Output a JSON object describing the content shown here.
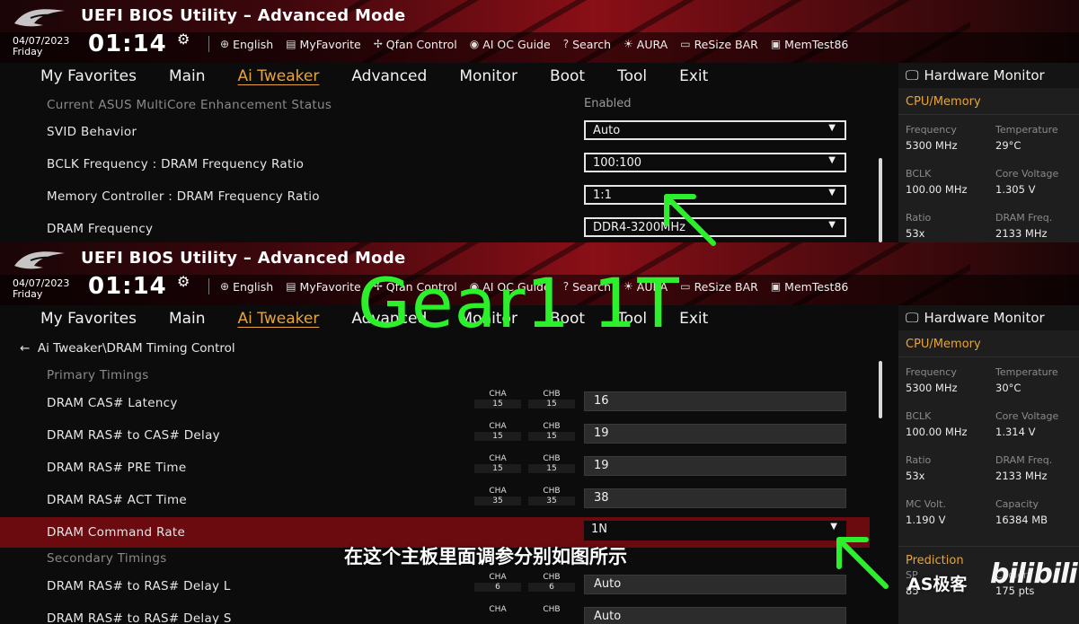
{
  "header": {
    "title": "UEFI BIOS Utility – Advanced Mode",
    "date": "04/07/2023",
    "day": "Friday",
    "time": "01:14",
    "toolbar": [
      {
        "icon": "globe-icon",
        "label": "English"
      },
      {
        "icon": "favorite-icon",
        "label": "MyFavorite"
      },
      {
        "icon": "fan-icon",
        "label": "Qfan Control"
      },
      {
        "icon": "ai-oc-icon",
        "label": "AI OC Guide"
      },
      {
        "icon": "search-icon",
        "label": "Search"
      },
      {
        "icon": "aura-icon",
        "label": "AURA"
      },
      {
        "icon": "resize-bar-icon",
        "label": "ReSize BAR"
      },
      {
        "icon": "memtest-icon",
        "label": "MemTest86"
      }
    ]
  },
  "nav": {
    "tabs": [
      "My Favorites",
      "Main",
      "Ai Tweaker",
      "Advanced",
      "Monitor",
      "Boot",
      "Tool",
      "Exit"
    ],
    "active": "Ai Tweaker"
  },
  "top_panel": {
    "rows": [
      {
        "label": "Current ASUS MultiCore Enhancement Status",
        "value": "Enabled"
      },
      {
        "label": "SVID Behavior",
        "value": "Auto"
      },
      {
        "label": "BCLK Frequency : DRAM Frequency Ratio",
        "value": "100:100"
      },
      {
        "label": "Memory Controller : DRAM Frequency Ratio",
        "value": "1:1"
      },
      {
        "label": "DRAM Frequency",
        "value": "DDR4-3200MHz"
      }
    ],
    "hw": {
      "title": "Hardware Monitor",
      "section": "CPU/Memory",
      "items": [
        {
          "k": "Frequency",
          "v": "5300 MHz"
        },
        {
          "k": "Temperature",
          "v": "29°C"
        },
        {
          "k": "BCLK",
          "v": "100.00 MHz"
        },
        {
          "k": "Core Voltage",
          "v": "1.305 V"
        },
        {
          "k": "Ratio",
          "v": "53x"
        },
        {
          "k": "DRAM Freq.",
          "v": "2133 MHz"
        }
      ]
    }
  },
  "bottom_panel": {
    "breadcrumb": "Ai Tweaker\\DRAM Timing Control",
    "primary_title": "Primary Timings",
    "secondary_title": "Secondary Timings",
    "cha_label": "CHA",
    "chb_label": "CHB",
    "rows": [
      {
        "label": "DRAM CAS# Latency",
        "cha": "15",
        "chb": "15",
        "value": "16"
      },
      {
        "label": "DRAM RAS# to CAS# Delay",
        "cha": "15",
        "chb": "15",
        "value": "19"
      },
      {
        "label": "DRAM RAS# PRE Time",
        "cha": "15",
        "chb": "15",
        "value": "19"
      },
      {
        "label": "DRAM RAS# ACT Time",
        "cha": "35",
        "chb": "35",
        "value": "38"
      },
      {
        "label": "DRAM Command Rate",
        "value": "1N"
      },
      {
        "label": "DRAM RAS# to RAS# Delay L",
        "cha": "6",
        "chb": "6",
        "value": "Auto"
      },
      {
        "label": "DRAM RAS# to RAS# Delay S",
        "value": "Auto"
      }
    ],
    "hw": {
      "title": "Hardware Monitor",
      "section": "CPU/Memory",
      "items": [
        {
          "k": "Frequency",
          "v": "5300 MHz"
        },
        {
          "k": "Temperature",
          "v": "30°C"
        },
        {
          "k": "BCLK",
          "v": "100.00 MHz"
        },
        {
          "k": "Core Voltage",
          "v": "1.314 V"
        },
        {
          "k": "Ratio",
          "v": "53x"
        },
        {
          "k": "DRAM Freq.",
          "v": "2133 MHz"
        },
        {
          "k": "MC Volt.",
          "v": "1.190 V"
        },
        {
          "k": "Capacity",
          "v": "16384 MB"
        }
      ],
      "prediction_title": "Prediction",
      "prediction_items": [
        {
          "k": "SP",
          "v": "85"
        },
        {
          "k": "Cooler",
          "v": "175 pts"
        }
      ]
    }
  },
  "overlay": {
    "headline": "Gear1 1T",
    "subtitle": "在这个主板里面调参分别如图所示",
    "author": "AS极客",
    "logo_text": "bilibili"
  },
  "colors": {
    "accent": "#e7a43a",
    "overlay_green": "#2df02d",
    "highlight_row": "#6b0b10",
    "header_red": "#8a0f17"
  }
}
